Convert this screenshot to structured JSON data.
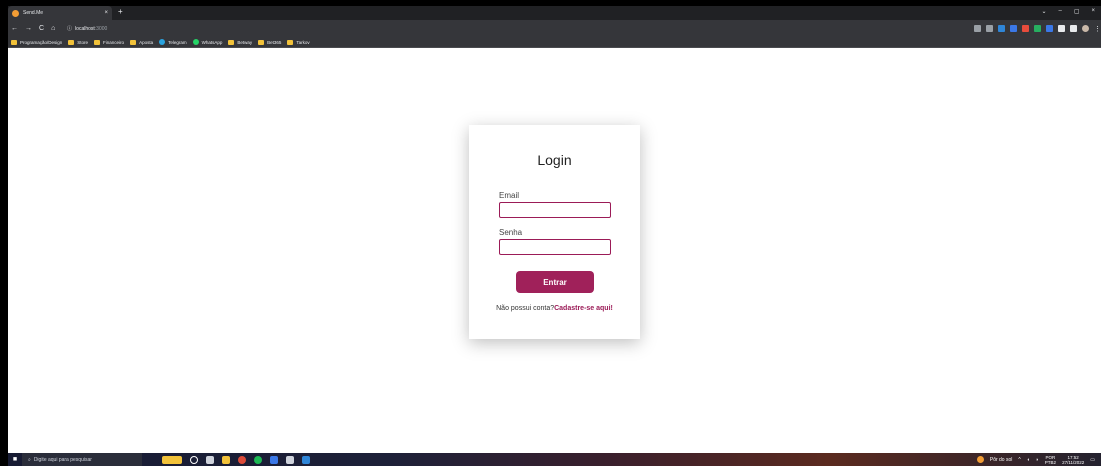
{
  "browser": {
    "tab_title": "Send.Me",
    "tab_close": "×",
    "new_tab": "+",
    "window_controls": [
      "⌄",
      "–",
      "▢",
      "×"
    ],
    "nav": {
      "back": "←",
      "forward": "→",
      "reload": "C",
      "home": "⌂"
    },
    "url_host": "localhost",
    "url_port": ":3000",
    "bookmarks": [
      {
        "label": "Programação/Design",
        "icon": "folder-icon"
      },
      {
        "label": "Store",
        "icon": "folder-icon"
      },
      {
        "label": "Financeiro",
        "icon": "folder-icon"
      },
      {
        "label": "Aposta",
        "icon": "folder-icon"
      },
      {
        "label": "Telegram",
        "icon": "telegram-icon"
      },
      {
        "label": "WhatsApp",
        "icon": "whatsapp-icon"
      },
      {
        "label": "Betway",
        "icon": "folder-icon"
      },
      {
        "label": "Bet365",
        "icon": "folder-icon"
      },
      {
        "label": "Tarkov",
        "icon": "folder-icon"
      }
    ]
  },
  "login": {
    "title": "Login",
    "email_label": "Email",
    "email_value": "",
    "password_label": "Senha",
    "password_value": "",
    "submit_label": "Entrar",
    "signup_prompt": "Não possui conta?",
    "signup_link": "Cadastre-se aqui!"
  },
  "taskbar": {
    "search_placeholder": "Digite aqui para pesquisar",
    "weather": "Pôr do sol",
    "lang_top": "POR",
    "lang_bottom": "PTB2",
    "time": "17:52",
    "date": "27/11/2022"
  },
  "colors": {
    "accent": "#a0215a",
    "input_border": "#9b1b57",
    "chrome_dark": "#35363a"
  }
}
